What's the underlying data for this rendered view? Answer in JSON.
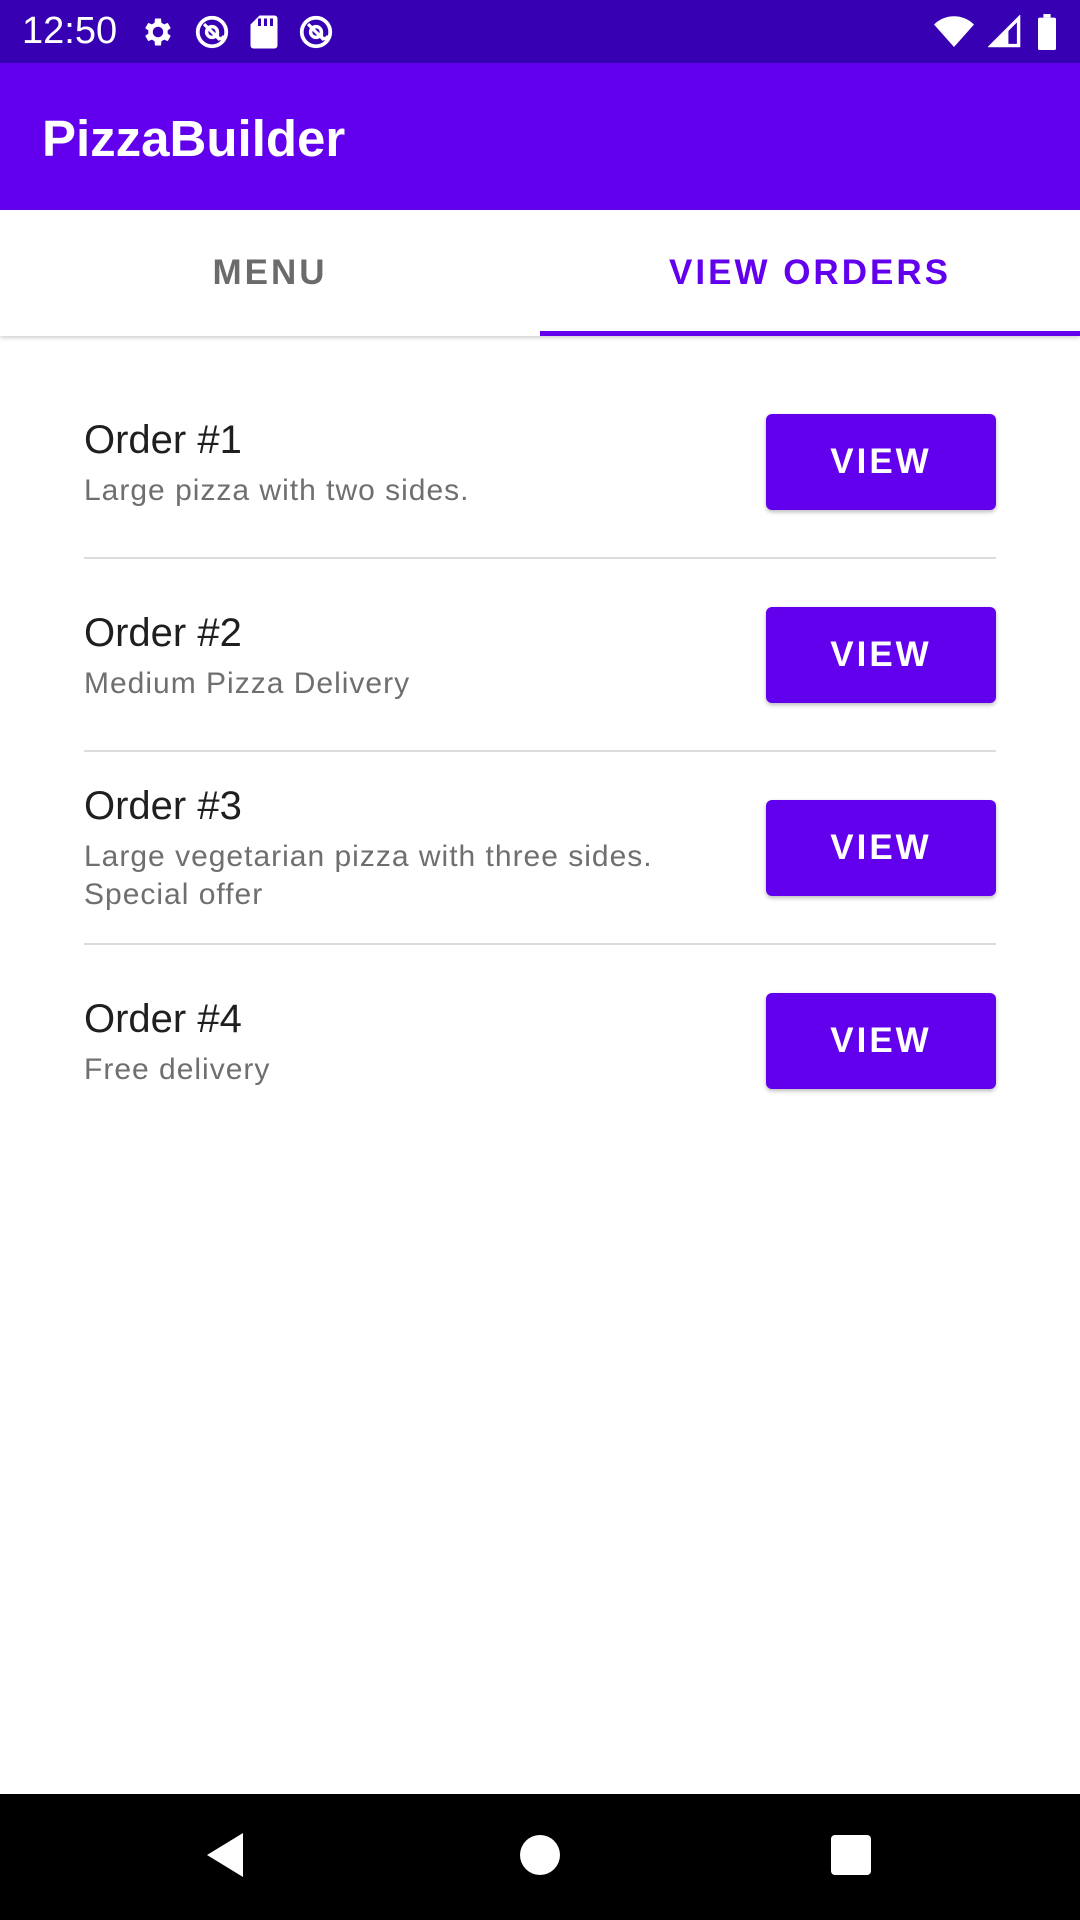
{
  "status_bar": {
    "time": "12:50",
    "icons": [
      "gear-icon",
      "at-sign-icon",
      "sd-card-icon",
      "at-sign-icon",
      "wifi-icon",
      "cell-signal-icon",
      "battery-icon"
    ]
  },
  "app_bar": {
    "title": "PizzaBuilder"
  },
  "tabs": [
    {
      "label": "MENU",
      "active": false
    },
    {
      "label": "VIEW ORDERS",
      "active": true
    }
  ],
  "orders": [
    {
      "title": "Order #1",
      "description": "Large pizza with two sides.",
      "button_label": "VIEW"
    },
    {
      "title": "Order #2",
      "description": "Medium Pizza Delivery",
      "button_label": "VIEW"
    },
    {
      "title": "Order #3",
      "description": "Large vegetarian pizza with three sides. Special offer",
      "button_label": "VIEW"
    },
    {
      "title": "Order #4",
      "description": "Free delivery",
      "button_label": "VIEW"
    }
  ],
  "nav_bar": {
    "icons": [
      "back-icon",
      "home-icon",
      "recents-icon"
    ]
  },
  "colors": {
    "primary": "#6200ee",
    "primary_dark": "#3700b3",
    "text_primary": "#1f1f1f",
    "text_secondary": "#6f6f6f",
    "divider": "#dcdcdc"
  }
}
